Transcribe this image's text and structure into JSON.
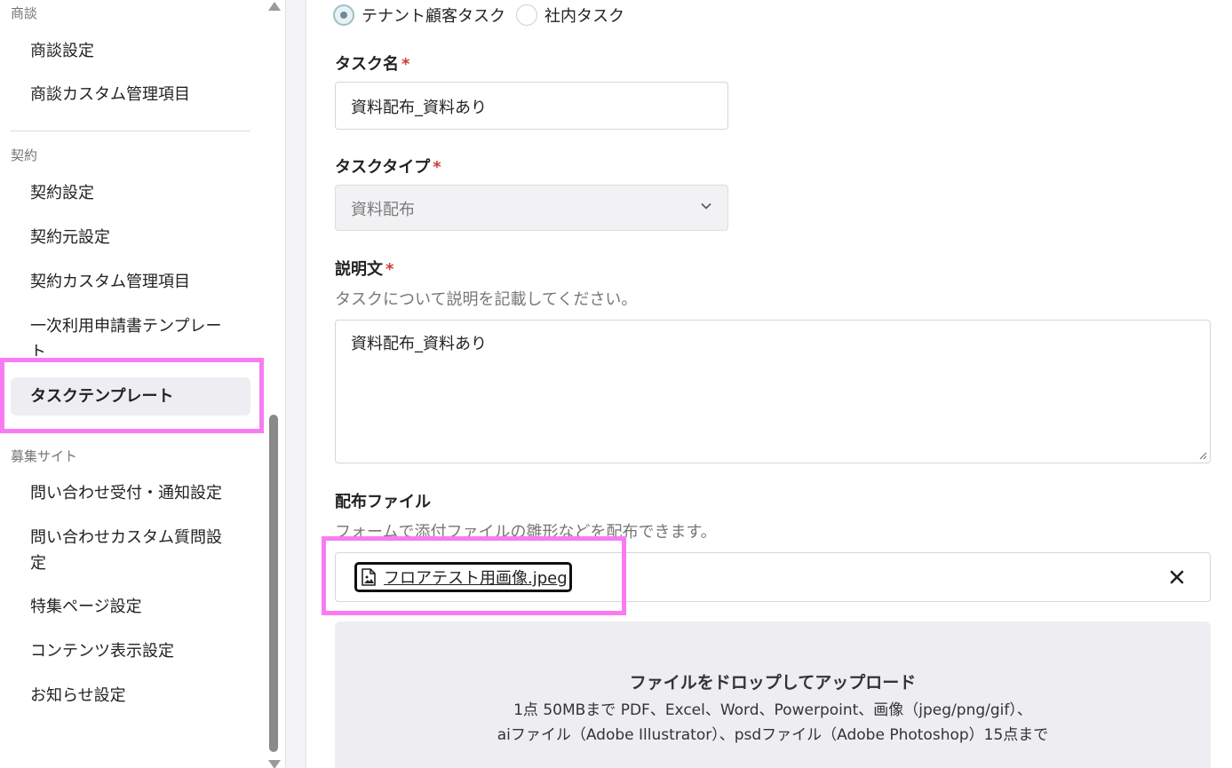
{
  "sidebar": {
    "groups": [
      {
        "label": "商談",
        "items": [
          "商談設定",
          "商談カスタム管理項目"
        ]
      },
      {
        "label": "契約",
        "items": [
          "契約設定",
          "契約元設定",
          "契約カスタム管理項目",
          "一次利用申請書テンプレート",
          "タスクテンプレート"
        ]
      },
      {
        "label": "募集サイト",
        "items": [
          "問い合わせ受付・通知設定",
          "問い合わせカスタム質問設定",
          "特集ページ設定",
          "コンテンツ表示設定",
          "お知らせ設定"
        ]
      }
    ],
    "active_item": "タスクテンプレート",
    "wrapped": {
      "template_line1": "一次利用申請書テンプレー",
      "template_line2": "ト",
      "custom_q_line1": "問い合わせカスタム質問設",
      "custom_q_line2": "定"
    }
  },
  "form": {
    "task_scope": {
      "options": [
        "テナント顧客タスク",
        "社内タスク"
      ],
      "selected": "テナント顧客タスク"
    },
    "task_name": {
      "label": "タスク名",
      "required_mark": "*",
      "value": "資料配布_資料あり"
    },
    "task_type": {
      "label": "タスクタイプ",
      "required_mark": "*",
      "value": "資料配布"
    },
    "description": {
      "label": "説明文",
      "required_mark": "*",
      "helper": "タスクについて説明を記載してください。",
      "value": "資料配布_資料あり"
    },
    "distribution_file": {
      "label": "配布ファイル",
      "helper": "フォームで添付ファイルの雛形などを配布できます。",
      "file_name": "フロアテスト用画像.jpeg",
      "file_icon": "image-file-icon",
      "remove_icon": "close-icon"
    },
    "dropzone": {
      "title": "ファイルをドロップしてアップロード",
      "line1": "1点 50MBまで PDF、Excel、Word、Powerpoint、画像（jpeg/png/gif）、",
      "line2": "aiファイル（Adobe Illustrator）、psdファイル（Adobe Photoshop）15点まで"
    }
  },
  "colors": {
    "highlight": "#f77cf3",
    "required": "#d03a3a",
    "active_bg": "#eeeef2"
  }
}
